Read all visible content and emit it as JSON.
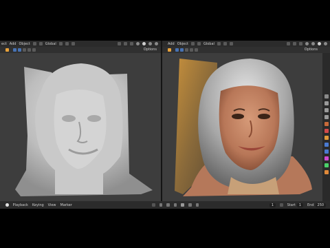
{
  "left_header": {
    "items": [
      "ect",
      "Add",
      "Object"
    ],
    "mode": "Global"
  },
  "right_header": {
    "items": [
      "Add",
      "Object"
    ],
    "mode": "Global"
  },
  "left_options": "Options",
  "right_options": "Options",
  "timeline": {
    "menu": [
      "Playback",
      "Keying",
      "View",
      "Marker"
    ],
    "current_frame": "1",
    "start_label": "Start",
    "start_value": "1",
    "end_label": "End",
    "end_value": "250"
  },
  "colors": {
    "viewport_bg": "#3d3d3d",
    "header_bg": "#2b2b2b",
    "accent": "#4772b3"
  }
}
